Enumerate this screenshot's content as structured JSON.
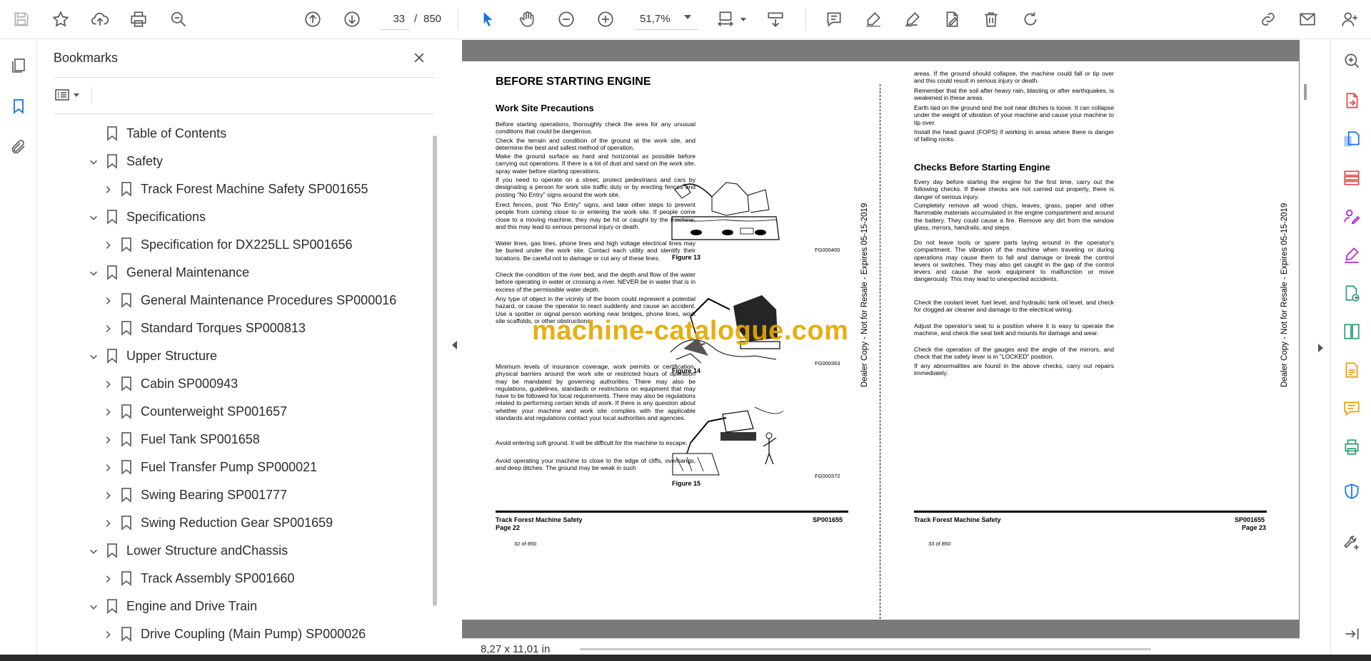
{
  "toolbar": {
    "page_current": "33",
    "page_separator": "/",
    "page_total": "850",
    "zoom_value": "51,7%",
    "icons": [
      "save-icon",
      "star-icon",
      "upload-icon",
      "print-icon",
      "find-icon",
      "prev-page-icon",
      "next-page-icon",
      "select-tool-icon",
      "hand-tool-icon",
      "zoom-out-icon",
      "zoom-in-icon",
      "page-fit-icon",
      "scroll-mode-icon",
      "comment-icon",
      "highlight-icon",
      "sign-icon",
      "fill-sign-icon",
      "delete-icon",
      "rotate-icon",
      "share-link-icon",
      "email-icon",
      "account-icon"
    ]
  },
  "left_rail": {
    "icons": [
      "page-thumbnails-icon",
      "bookmarks-icon",
      "attachments-icon"
    ]
  },
  "bookmarks": {
    "title": "Bookmarks",
    "items": [
      {
        "label": "Table of Contents",
        "level": 0,
        "expandable": false,
        "expanded": false
      },
      {
        "label": "Safety",
        "level": 0,
        "expandable": true,
        "expanded": true
      },
      {
        "label": "Track Forest Machine Safety SP001655",
        "level": 1,
        "expandable": true,
        "expanded": false
      },
      {
        "label": "Specifications",
        "level": 0,
        "expandable": true,
        "expanded": true
      },
      {
        "label": "Specification for DX225LL SP001656",
        "level": 1,
        "expandable": true,
        "expanded": false
      },
      {
        "label": "General Maintenance",
        "level": 0,
        "expandable": true,
        "expanded": true
      },
      {
        "label": "General Maintenance Procedures SP000016",
        "level": 1,
        "expandable": true,
        "expanded": false
      },
      {
        "label": "Standard Torques SP000813",
        "level": 1,
        "expandable": true,
        "expanded": false
      },
      {
        "label": "Upper Structure",
        "level": 0,
        "expandable": true,
        "expanded": true
      },
      {
        "label": "Cabin SP000943",
        "level": 1,
        "expandable": true,
        "expanded": false
      },
      {
        "label": "Counterweight SP001657",
        "level": 1,
        "expandable": true,
        "expanded": false
      },
      {
        "label": "Fuel Tank SP001658",
        "level": 1,
        "expandable": true,
        "expanded": false
      },
      {
        "label": "Fuel Transfer Pump SP000021",
        "level": 1,
        "expandable": true,
        "expanded": false
      },
      {
        "label": "Swing Bearing SP001777",
        "level": 1,
        "expandable": true,
        "expanded": false
      },
      {
        "label": "Swing Reduction Gear SP001659",
        "level": 1,
        "expandable": true,
        "expanded": false
      },
      {
        "label": "Lower Structure andChassis",
        "level": 0,
        "expandable": true,
        "expanded": true
      },
      {
        "label": "Track Assembly SP001660",
        "level": 1,
        "expandable": true,
        "expanded": false
      },
      {
        "label": "Engine and Drive Train",
        "level": 0,
        "expandable": true,
        "expanded": true
      },
      {
        "label": "Drive Coupling (Main Pump) SP000026",
        "level": 1,
        "expandable": true,
        "expanded": false
      }
    ]
  },
  "document": {
    "left_page": {
      "title": "BEFORE STARTING ENGINE",
      "section": "Work Site Precautions",
      "paragraphs": [
        "Before starting operations, thoroughly check the area for any unusual conditions that could be dangerous.",
        "Check the terrain and condition of the ground at the work site, and determine the best and safest method of operation.",
        "Make the ground surface as hard and horizontal as possible before carrying out operations. If there is a lot of dust and sand on the work site, spray water before starting operations.",
        "If you need to operate on a street, protect pedestrians and cars by designating a person for work site traffic duty or by erecting fences and posting \"No Entry\" signs around the work site.",
        "Erect fences, post \"No Entry\" signs, and take other steps to prevent people from coming close to or entering the work site. If people come close to a moving machine, they may be hit or caught by the machine, and this may lead to serious personal injury or death.",
        "Water lines, gas lines, phone lines and high voltage electrical lines may be buried under the work site. Contact each utility and identify their locations. Be careful not to damage or cut any of these lines.",
        "Check the condition of the river bed, and the depth and flow of the water before operating in water or crossing a river. NEVER be in water that is in excess of the permissible water depth.",
        "Any type of object in the vicinity of the boom could represent a potential hazard, or cause the operator to react suddenly and cause an accident. Use a spotter or signal person working near bridges, phone lines, work site scaffolds, or other obstructions.",
        "Minimum levels of insurance coverage, work permits or certification, physical barriers around the work site or restricted hours of operation may be mandated by governing authorities. There may also be regulations, guidelines, standards or restrictions on equipment that may have to be followed for local requirements. There may also be regulations related to performing certain kinds of work. If there is any question about whether your machine and work site complies with the applicable standards and regulations contact your local authorities and agencies.",
        "Avoid entering soft ground. It will be difficult for the machine to escape.",
        "Avoid operating your machine to close to the edge of cliffs, overhangs, and deep ditches. The ground may be weak in such"
      ],
      "figures": [
        {
          "caption": "Figure 13",
          "code": "FG000400"
        },
        {
          "caption": "Figure 14",
          "code": "FG000363"
        },
        {
          "caption": "Figure 15",
          "code": "FG000372"
        }
      ],
      "vertical_note": "Dealer Copy - Not for Resale - Expires 05-15-2019",
      "footer_title": "Track Forest Machine Safety",
      "footer_page": "Page 22",
      "footer_code": "SP001655",
      "page_counter": "32 of 850"
    },
    "right_page": {
      "paragraphs_top": [
        "areas. If the ground should collapse, the machine could fall or tip over and this could result in serious injury or death.",
        "Remember that the soil after heavy rain, blasting or after earthquakes, is weakened in these areas.",
        "Earth laid on the ground and the soil near ditches is loose. It can collapse under the weight of vibration of your machine and cause your machine to tip over.",
        "Install the head guard (FOPS) if working in areas where there is danger of falling rocks."
      ],
      "section": "Checks Before Starting Engine",
      "paragraphs": [
        "Every day before starting the engine for the first time, carry out the following checks. If these checks are not carried out properly, there is danger of serious injury.",
        "Completely remove all wood chips, leaves, grass, paper and other flammable materials accumulated in the engine compartment and around the battery. They could cause a fire. Remove any dirt from the window glass, mirrors, handrails, and steps.",
        "Do not leave tools or spare parts laying around in the operator's compartment. The vibration of the machine when traveling or during operations may cause them to fall and damage or break the control levers or switches. They may also get caught in the gap of the control levers and cause the work equipment to malfunction or move dangerously. This may lead to unexpected accidents.",
        "Check the coolant level, fuel level, and hydraulic tank oil level, and check for clogged air cleaner and damage to the electrical wiring.",
        "Adjust the operator's seat to a position where it is easy to operate the machine, and check the seat belt and mounts for damage and wear.",
        "Check the operation of the gauges and the angle of the mirrors, and check that the safety lever is in \"LOCKED\" position.",
        "If any abnormalities are found in the above checks, carry out repairs immediately."
      ],
      "vertical_note": "Dealer Copy - Not for Resale - Expires 05-15-2019",
      "footer_title": "Track Forest Machine Safety",
      "footer_page": "Page 23",
      "footer_code": "SP001655",
      "page_counter": "33 of 850"
    },
    "watermark": "machine-catalogue.com"
  },
  "status": {
    "page_size": "8,27 x 11,01 in"
  },
  "right_rail": {
    "icons": [
      {
        "name": "zoom-search-icon",
        "color": "#5a5a5a"
      },
      {
        "name": "export-pdf-icon",
        "color": "#e34850"
      },
      {
        "name": "create-pdf-icon",
        "color": "#1473e6"
      },
      {
        "name": "organize-pages-icon",
        "color": "#e34850"
      },
      {
        "name": "request-signature-icon",
        "color": "#b620e0"
      },
      {
        "name": "fill-and-sign-icon",
        "color": "#b620e0"
      },
      {
        "name": "send-for-review-icon",
        "color": "#2d9d78"
      },
      {
        "name": "compare-files-icon",
        "color": "#2d9d78"
      },
      {
        "name": "comment-tool-icon",
        "color": "#e8a100"
      },
      {
        "name": "sticky-note-icon",
        "color": "#e8a100"
      },
      {
        "name": "print-production-icon",
        "color": "#2d9d78"
      },
      {
        "name": "protect-icon",
        "color": "#1473e6"
      },
      {
        "name": "more-tools-icon",
        "color": "#5a5a5a"
      },
      {
        "name": "expand-panel-icon",
        "color": "#5a5a5a"
      }
    ]
  }
}
